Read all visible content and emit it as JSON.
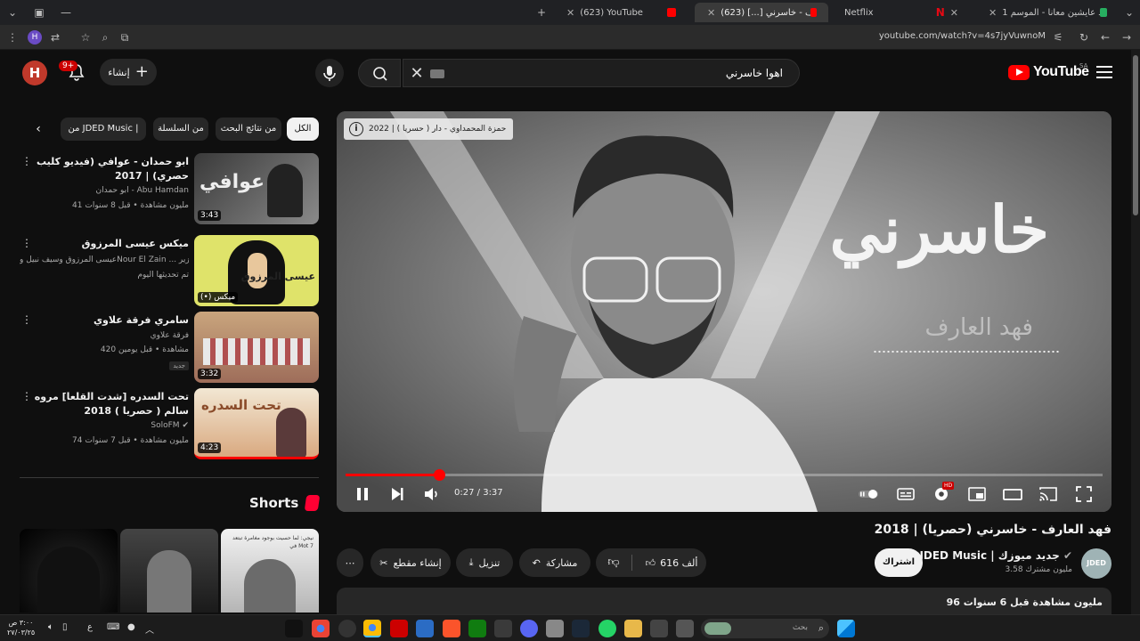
{
  "browser": {
    "tabs": [
      {
        "title": "(623) YouTube",
        "active": false
      },
      {
        "title": "فهد العارف - خاسرني [...] (623)",
        "active": true
      },
      {
        "title": "Netflix",
        "active": false
      },
      {
        "title": "شاهد عايشين معانا - الموسم 1",
        "active": false
      }
    ],
    "url": "youtube.com/watch?v=4s7jyVuwnoM",
    "profile_initial": "H"
  },
  "masthead": {
    "logo_text": "YouTube",
    "country": "SA",
    "search_value": "اهوا خاسرني",
    "create_label": "إنشاء",
    "notification_count": "9+",
    "avatar_initial": "H"
  },
  "player": {
    "info_text": "حمزة المحمداوي - دار ( حسريا ) | 2022",
    "art_title": "خاسرني",
    "art_artist": "فهد العارف",
    "current_time": "0:27",
    "duration": "3:37",
    "progress_fraction": 0.124,
    "time_separator": " / ",
    "hd_badge": "HD"
  },
  "video": {
    "title": "فهد العارف - خاسرني (حصريا) | 2018",
    "channel_name": "JDED Music | جديد ميوزك",
    "channel_subs": "3.58 مليون مشترك",
    "channel_avatar_text": "JDED",
    "subscribe_label": "اشتراك",
    "like_count": "616 ألف",
    "share_label": "مشاركة",
    "download_label": "تنزيل",
    "clip_label": "إنشاء مقطع",
    "description_views": "96 مليون مشاهدة قبل 6 سنوات"
  },
  "chips": [
    {
      "label": "الكل",
      "active": true
    },
    {
      "label": "من نتائج البحث",
      "active": false
    },
    {
      "label": "من السلسلة",
      "active": false
    },
    {
      "label": "من JDED Music |",
      "active": false
    }
  ],
  "recommendations": [
    {
      "title": "ابو حمدان - عوافي (فيديو كليب حصري) | 2017",
      "channel": "ابو حمدان - Abu Hamdan",
      "views": "41 مليون مشاهدة • قبل 8 سنوات",
      "duration": "3:43",
      "badge": "",
      "thumb_text": "عوافي"
    },
    {
      "title": "ميكس عيسى المرزوق",
      "channel": "عيسى المرزوق وسيف نبيل وNour El Zain ... ادر الزير",
      "views": "تم تحديثها اليوم",
      "duration": "(•) ميكس",
      "badge": "",
      "thumb_text": "عيسى المرزوق"
    },
    {
      "title": "سامري فرقة علاوي",
      "channel": "فرقة علاوي",
      "views": "420 مشاهدة • قبل يومين",
      "duration": "3:32",
      "badge": "جديد",
      "thumb_text": ""
    },
    {
      "title": "تحت السدره [شدت القلعا] مروه سالم ( حصريا ) 2018",
      "channel": "SoloFM",
      "views": "74 مليون مشاهدة • قبل 7 سنوات",
      "duration": "4:23",
      "badge": "",
      "thumb_text": "تحت السدره"
    }
  ],
  "shorts": {
    "heading": "Shorts",
    "items": [
      {
        "caption": ""
      },
      {
        "caption": ""
      },
      {
        "caption": "نيجي: لما حسيت بوجود مغامرة تبتعد في Mot 7"
      }
    ]
  },
  "taskbar": {
    "search_placeholder": "بحث",
    "time": "٣:٠٠ ص",
    "date": "٢٧/٠٣/٢٥"
  },
  "colors": {
    "accent_red": "#ff0000",
    "background": "#0f0f0f",
    "surface": "#272727"
  }
}
